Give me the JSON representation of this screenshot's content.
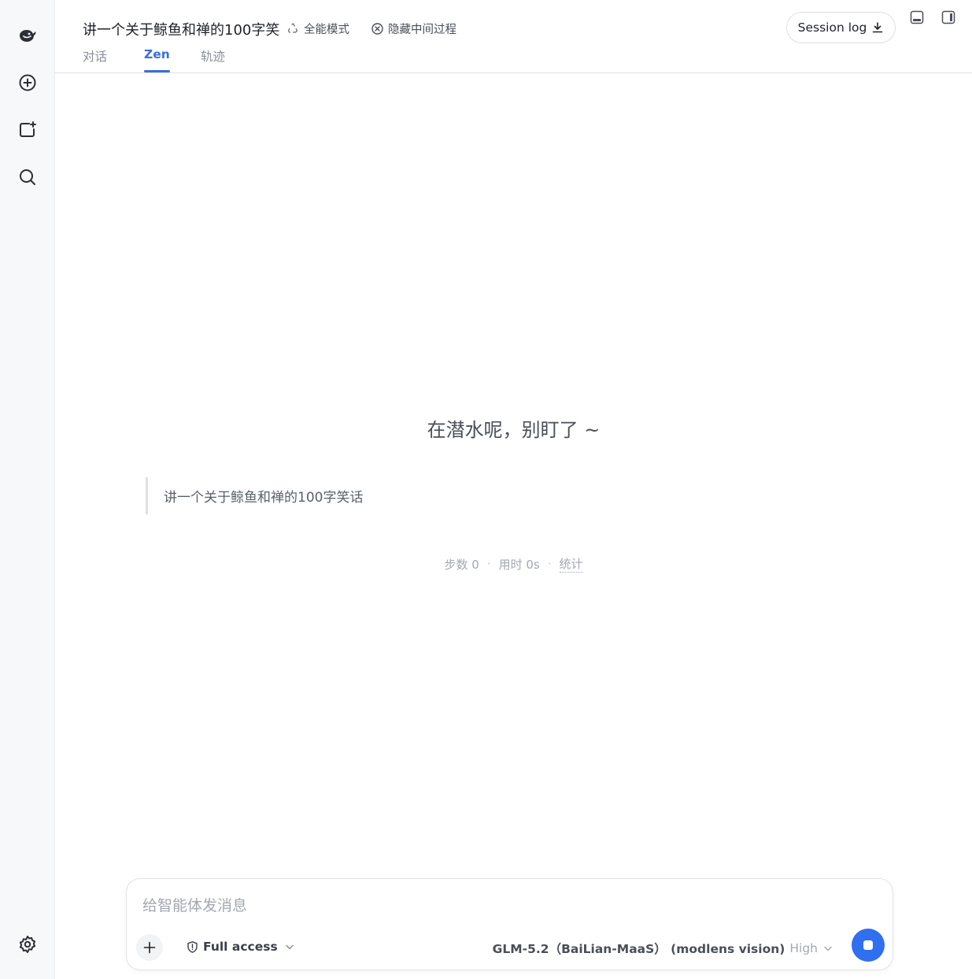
{
  "rail": {
    "logo_icon": "whale-logo",
    "items": [
      {
        "name": "new-chat-icon"
      },
      {
        "name": "new-project-icon"
      },
      {
        "name": "search-icon"
      }
    ],
    "settings_icon": "settings-icon"
  },
  "header": {
    "title": "讲一个关于鲸鱼和禅的100字笑",
    "mode_label": "全能模式",
    "hide_label": "隐藏中间过程",
    "tabs": [
      {
        "label": "对话",
        "active": false
      },
      {
        "label": "Zen",
        "active": true
      },
      {
        "label": "轨迹",
        "active": false
      }
    ],
    "session_log_label": "Session log"
  },
  "main": {
    "status_message": "在潜水呢，别盯了 ~",
    "quote": "讲一个关于鲸鱼和禅的100字笑话",
    "stats": {
      "steps": "步数 0",
      "sep": "·",
      "elapsed": "用时 0s",
      "link": "统计"
    }
  },
  "composer": {
    "placeholder": "给智能体发消息",
    "access_label": "Full access",
    "model_label": "GLM-5.2（BaiLian-MaaS） (modlens vision)",
    "level_label": "High"
  },
  "colors": {
    "accent": "#3a6fd8",
    "send_button": "#2f6ff0"
  }
}
